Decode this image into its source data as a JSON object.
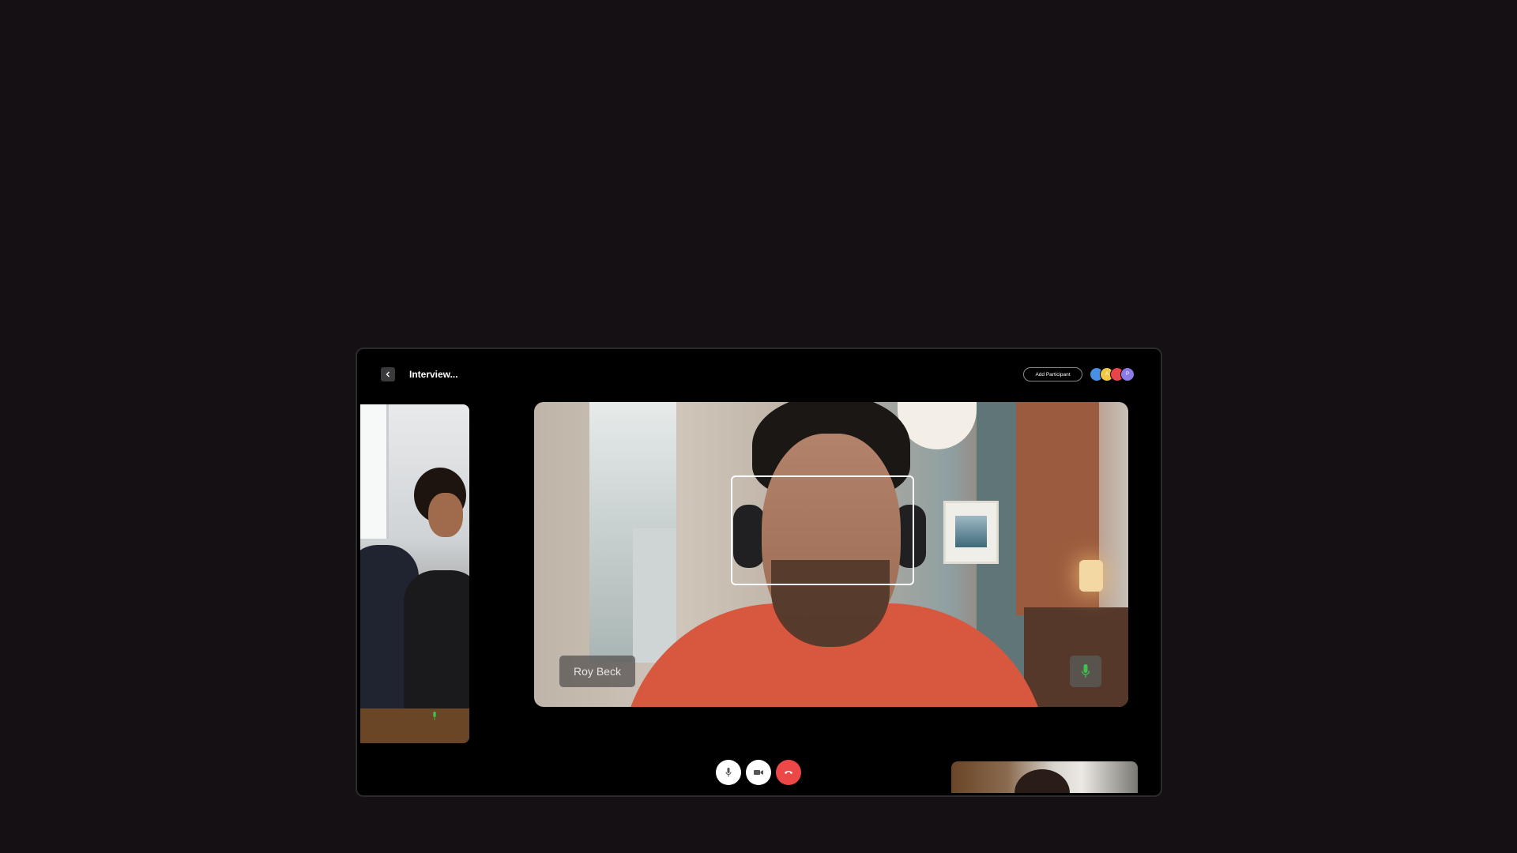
{
  "header": {
    "title": "Interview...",
    "add_participant_label": "Add Participant",
    "avatars": [
      {
        "initial": "",
        "color": "#4a90e2"
      },
      {
        "initial": "A",
        "color": "#f2c744"
      },
      {
        "initial": "",
        "color": "#e8454b"
      },
      {
        "initial": "P",
        "color": "#8c7ae6"
      }
    ]
  },
  "main_video": {
    "participant_name": "Roy Beck",
    "mic_status": "on"
  },
  "side_video": {
    "mic_status": "on"
  },
  "controls": {
    "mic_icon": "microphone-icon",
    "camera_icon": "video-camera-icon",
    "hangup_icon": "phone-hangup-icon",
    "hangup_color": "#ec4848"
  },
  "colors": {
    "background": "#141014",
    "window": "#000000",
    "mic_active": "#3ec24f"
  }
}
